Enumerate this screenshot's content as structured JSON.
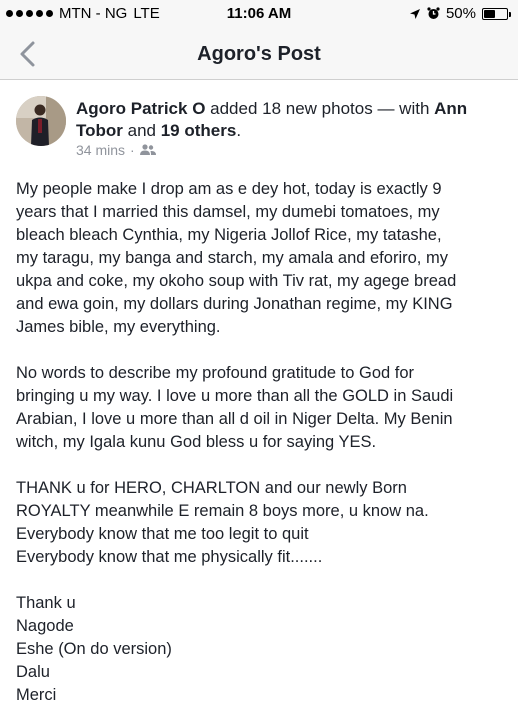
{
  "status_bar": {
    "carrier": "MTN - NG",
    "network": "LTE",
    "time": "11:06 AM",
    "battery_percent": "50%",
    "battery_level": 0.5,
    "signal_bars_filled": 5
  },
  "nav": {
    "title": "Agoro's Post",
    "back_icon": "chevron-left-icon"
  },
  "post": {
    "author": "Agoro Patrick O",
    "action": " added 18 new photos — with ",
    "tagged_first": "Ann Tobor",
    "and_text": " and ",
    "tagged_others": "19 others",
    "period": ".",
    "time_ago": "34 mins",
    "separator": "·",
    "audience_icon": "friends-icon",
    "paragraph1": [
      "My people make I drop am as e dey hot, today is exactly 9",
      "years that I married this damsel, my dumebi tomatoes, my",
      "bleach bleach Cynthia, my Nigeria Jollof Rice,  my tatashe,",
      "my taragu, my banga and starch, my amala and eforiro, my",
      "ukpa and coke, my okoho soup with Tiv rat, my agege bread",
      "and ewa goin, my dollars during Jonathan regime, my KING",
      "James bible, my everything."
    ],
    "paragraph2": [
      "No words to describe my profound gratitude to God for",
      "bringing u my way. I love u more than all the GOLD in Saudi",
      "Arabian, I love u more than all d oil in Niger Delta. My Benin",
      "witch, my Igala kunu God bless u for saying YES."
    ],
    "paragraph3": [
      "THANK u for HERO, CHARLTON and our newly Born",
      "ROYALTY meanwhile E remain 8 boys more, u know na.",
      "Everybody know that me too legit to quit",
      "Everybody know that me physically fit......."
    ],
    "paragraph4": [
      "Thank u",
      "Nagode",
      "Eshe  (On do version)",
      "Dalu",
      "Merci"
    ]
  }
}
